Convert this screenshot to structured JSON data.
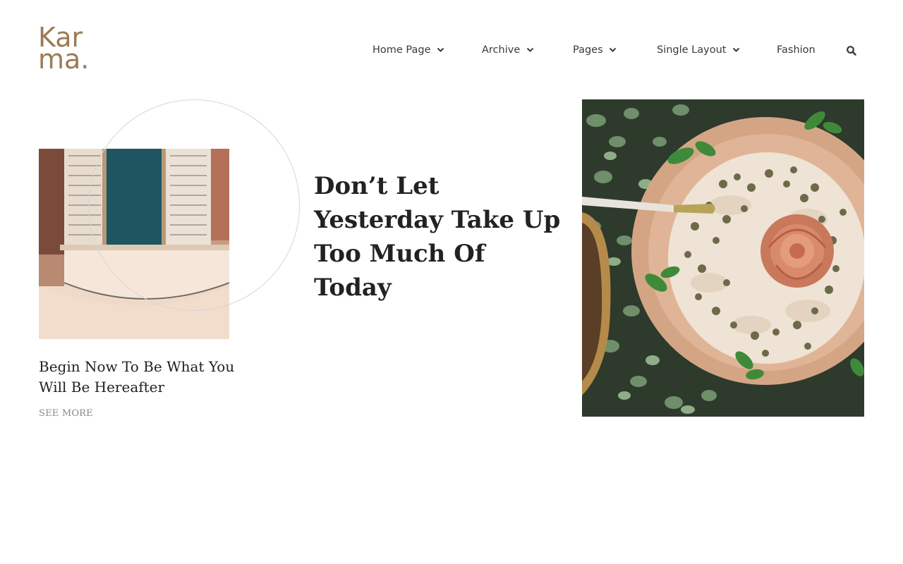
{
  "header": {
    "logo_line1": "Kar",
    "logo_line2": "ma.",
    "nav": [
      {
        "label": "Home Page",
        "has_dropdown": true
      },
      {
        "label": "Archive",
        "has_dropdown": true
      },
      {
        "label": "Pages",
        "has_dropdown": true
      },
      {
        "label": "Single Layout",
        "has_dropdown": true
      },
      {
        "label": "Fashion",
        "has_dropdown": false
      }
    ],
    "search_icon": "search-icon"
  },
  "left_post": {
    "title": "Begin Now To Be What You Will Be Hereafter",
    "cta": "SEE MORE",
    "image": "dam-aerial-image"
  },
  "hero_post": {
    "title": "Don’t Let Yesterday Take Up Too Much Of Today"
  },
  "right_post": {
    "image": "food-plate-image"
  },
  "colors": {
    "brand": "#9b7b55",
    "text": "#222222",
    "muted": "#8a8a8a",
    "circle": "#d6d6d6"
  }
}
